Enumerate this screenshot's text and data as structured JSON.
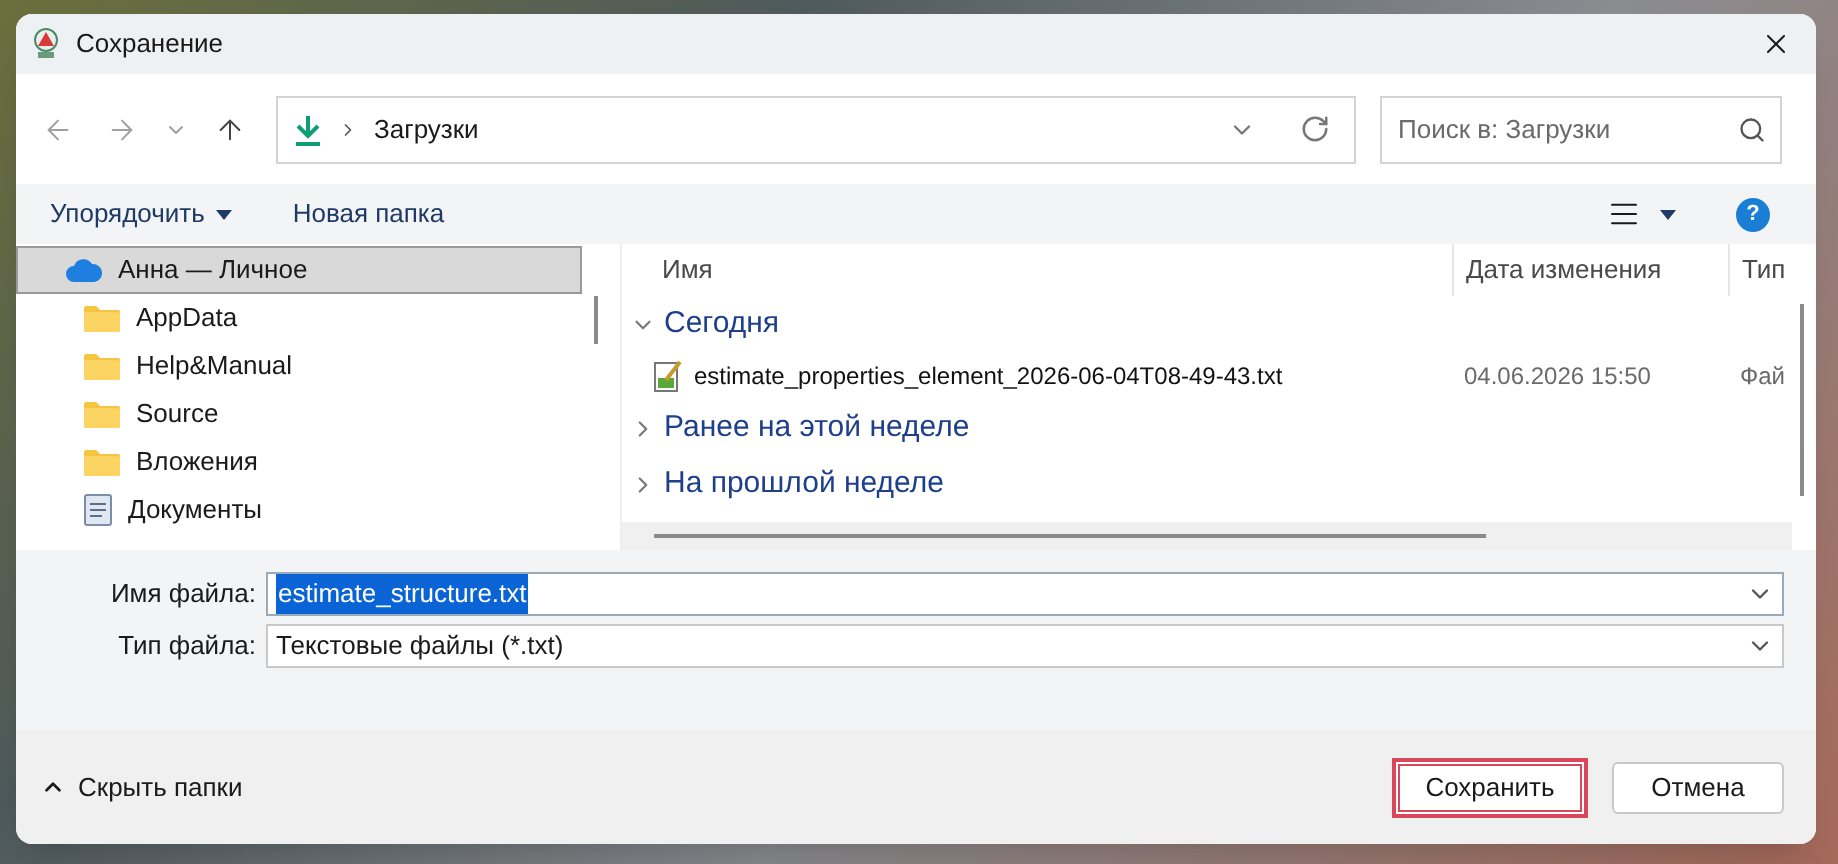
{
  "window": {
    "title": "Сохранение"
  },
  "address": {
    "path": "Загрузки"
  },
  "search": {
    "placeholder": "Поиск в: Загрузки"
  },
  "toolbar": {
    "organize": "Упорядочить",
    "new_folder": "Новая папка",
    "help": "?"
  },
  "sidebar": {
    "items": [
      {
        "label": "Анна — Личное",
        "kind": "cloud",
        "selected": true
      },
      {
        "label": "AppData",
        "kind": "folder",
        "selected": false
      },
      {
        "label": "Help&Manual",
        "kind": "folder",
        "selected": false
      },
      {
        "label": "Source",
        "kind": "folder",
        "selected": false
      },
      {
        "label": "Вложения",
        "kind": "folder",
        "selected": false
      },
      {
        "label": "Документы",
        "kind": "documents",
        "selected": false
      }
    ]
  },
  "file_list": {
    "columns": [
      "Имя",
      "Дата изменения",
      "Тип"
    ],
    "groups": [
      {
        "label": "Сегодня",
        "expanded": true,
        "files": [
          {
            "name": "estimate_properties_element_2026-06-04T08-49-43.txt",
            "date": "04.06.2026 15:50",
            "type": "Фай"
          }
        ]
      },
      {
        "label": "Ранее на этой неделе",
        "expanded": false
      },
      {
        "label": "На прошлой неделе",
        "expanded": false
      }
    ]
  },
  "form": {
    "file_name_label": "Имя файла:",
    "file_name": "estimate_structure.txt",
    "file_type_label": "Тип файла:",
    "file_type": "Текстовые файлы (*.txt)"
  },
  "footer": {
    "hide_folders": "Скрыть папки",
    "save": "Сохранить",
    "cancel": "Отмена"
  }
}
